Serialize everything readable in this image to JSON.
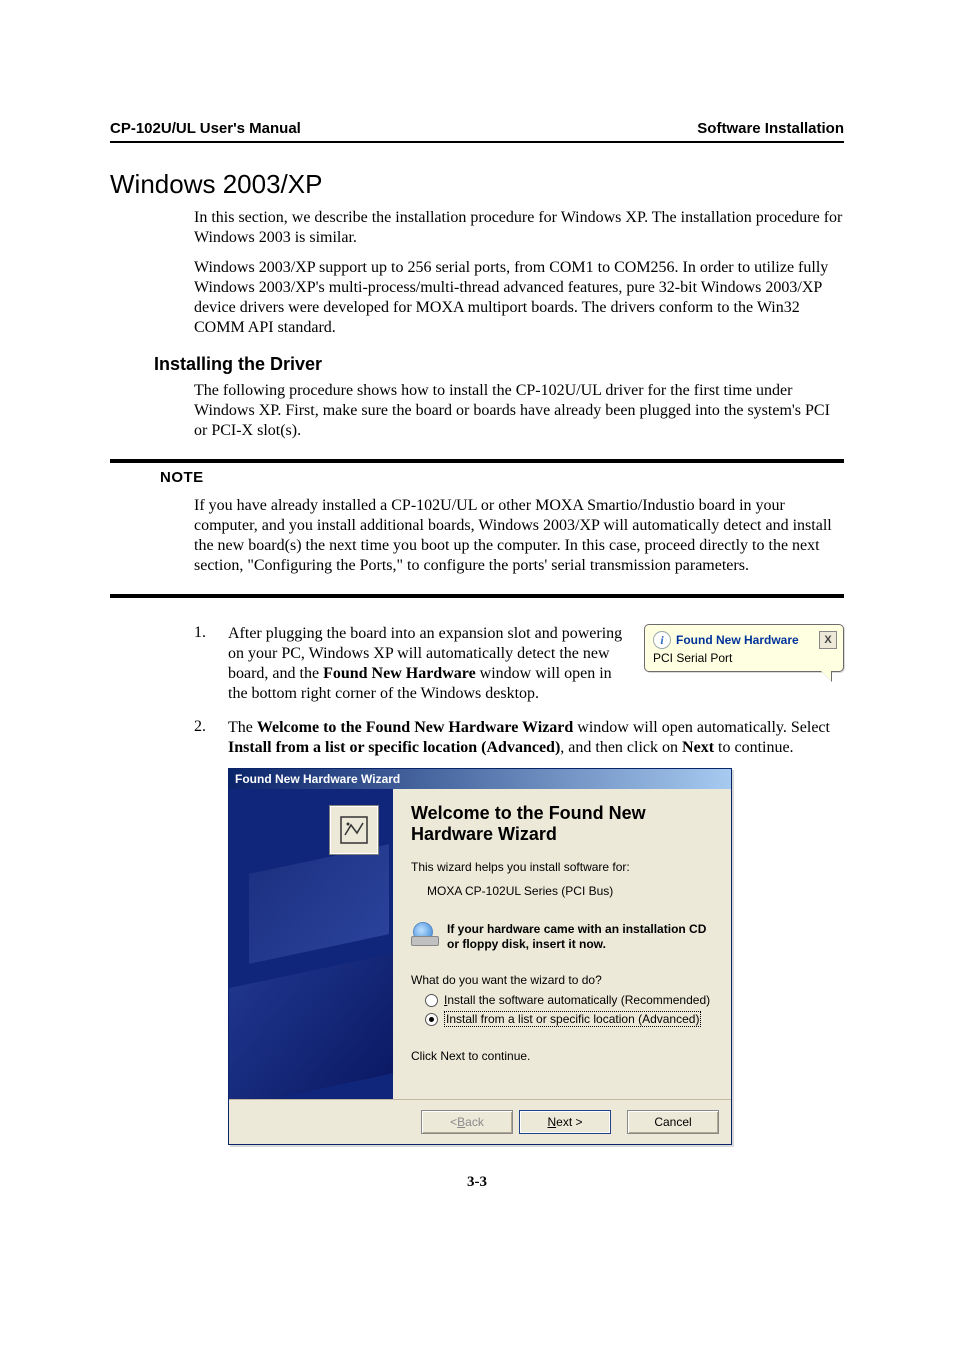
{
  "header": {
    "left": "CP-102U/UL User's Manual",
    "right": "Software Installation"
  },
  "section_title": "Windows 2003/XP",
  "intro_p1": "In this section, we describe the installation procedure for Windows XP. The installation procedure for Windows 2003 is similar.",
  "intro_p2": "Windows 2003/XP support up to 256 serial ports, from COM1 to COM256. In order to utilize fully Windows 2003/XP's multi-process/multi-thread advanced features, pure 32-bit Windows 2003/XP device drivers were developed for MOXA multiport boards. The drivers conform to the Win32 COMM API standard.",
  "subsection_title": "Installing the Driver",
  "sub_p1": "The following procedure shows how to install the CP-102U/UL driver for the first time under Windows XP. First, make sure the board or boards have already been plugged into the system's PCI or PCI-X slot(s).",
  "note": {
    "label": "NOTE",
    "body": "If you have already installed a CP-102U/UL or other MOXA Smartio/Industio board in your computer, and you install additional boards, Windows 2003/XP will automatically detect and install the new board(s) the next time you boot up the computer. In this case, proceed directly to the next section, \"Configuring the Ports,\" to configure the ports' serial transmission parameters."
  },
  "steps": {
    "s1": {
      "num": "1.",
      "pre": "After plugging the board into an expansion slot and powering on your PC, Windows XP will automatically detect the new board, and the ",
      "bold": "Found New Hardware",
      "post": " window will open in the bottom right corner of the Windows desktop."
    },
    "s2": {
      "num": "2.",
      "pre": "The ",
      "bold1": "Welcome to the Found New Hardware Wizard",
      "mid1": " window will open automatically. Select ",
      "bold2": "Install from a list or specific location (Advanced)",
      "mid2": ", and then click on ",
      "bold3": "Next",
      "post": " to continue."
    }
  },
  "balloon": {
    "title": "Found New Hardware",
    "subtitle": "PCI Serial Port",
    "close": "X",
    "info_glyph": "i"
  },
  "wizard": {
    "titlebar": "Found New Hardware Wizard",
    "heading": "Welcome to the Found New Hardware Wizard",
    "help_line": "This wizard helps you install software for:",
    "device_name": "MOXA CP-102UL Series (PCI Bus)",
    "cd_hint": "If your hardware came with an installation CD or floppy disk, insert it now.",
    "question": "What do you want the wizard to do?",
    "opt1_pre": "I",
    "opt1_rest": "nstall the software automatically (Recommended)",
    "opt2": "Install from a list or specific location (Advanced)",
    "click_next": "Click Next to continue.",
    "btn_back_pre": "< ",
    "btn_back_u": "B",
    "btn_back_post": "ack",
    "btn_next_u": "N",
    "btn_next_post": "ext >",
    "btn_cancel": "Cancel"
  },
  "page_number": "3-3"
}
